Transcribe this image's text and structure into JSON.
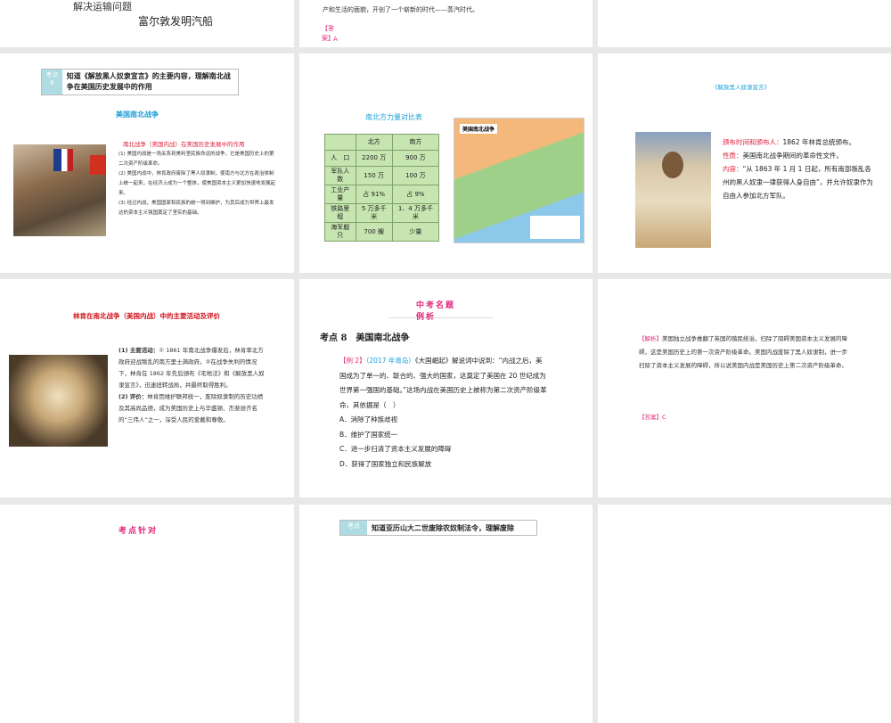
{
  "slides": {
    "s0a": {
      "line1": "解决运输问题",
      "line2": "富尔敦发明汽船"
    },
    "s0b": {
      "text": "产和生活的面貌，开创了一个崭新的时代——蒸汽时代。",
      "answer_label": "【答案】",
      "answer": "A"
    },
    "s1": {
      "kd_label": "考点8",
      "kd_text": "知道《解放黑人奴隶宣言》的主要内容，理解南北战争在美国历史发展中的作用",
      "title": "美国南北战争",
      "subtitle": "南北战争（美国内战）在美国历史发展中的作用",
      "p1": "(1) 美国内战是一场关系到美利坚民族命运的战争，它是美国历史上的第二次资产阶级革命。",
      "p2": "(2) 美国内战中，林肯政府废除了黑人奴隶制，使南方与北方在政治体制上统一起来，在经济上成为一个整体，使美国资本主义更加快速地发展起来。",
      "p3": "(3) 经过内战，美国国家和民族的统一得到维护，为其后成为世界上最发达的资本主义强国奠定了坚实的基础。"
    },
    "s2": {
      "title": "南北方力量对比表",
      "headers": [
        "",
        "北方",
        "南方"
      ],
      "rows": [
        [
          "人　口",
          "2200 万",
          "900 万"
        ],
        [
          "军队人数",
          "150 万",
          "100 万"
        ],
        [
          "工业产量",
          "占 91%",
          "占 9%"
        ],
        [
          "铁路里程",
          "5 万多千米",
          "1．4 万多千米"
        ],
        [
          "海军舰只",
          "700 艘",
          "少量"
        ]
      ],
      "map_title": "美国南北战争"
    },
    "s3": {
      "title": "《解放黑人奴隶宣言》",
      "l1": "颁布时间和颁布人：",
      "v1": "1862 年林肯总统颁布。",
      "l2": "性质：",
      "v2": "美国南北战争期间的革命性文件。",
      "l3": "内容：",
      "v3": "“从 1863 年 1 月 1 日起，所有南部叛乱各州的黑人奴隶一律获得人身自由”，并允许奴隶作为自由人参加北方军队。"
    },
    "s4": {
      "title": "林肯在南北战争（美国内战）中的主要活动及评价",
      "l1": "(1) 主要活动：",
      "v1": "① 1861 年南北战争爆发后，林肯率北方政府迎战叛乱的南方里士满政府。②在战争失利的情况下，林肯在 1862 年先后颁布《宅地法》和《解放黑人奴隶宣言》，迅速扭转战局，并最终取得胜利。",
      "l2": "(2) 评价：",
      "v2": "林肯因维护联邦统一，废除奴隶制的历史功绩及其高尚品德，成为美国历史上与华盛顿、杰斐逊齐名的“三伟人”之一，深受人民的爱戴和尊敬。"
    },
    "s5": {
      "banner1": "中考名题",
      "banner2": "例析",
      "heading": "考点 8　美国南北战争",
      "ex": "【例 2】",
      "src": "（2017 年青岛）",
      "q": "《大国崛起》解说词中说到：“内战之后，美国成为了单一的、联合的、强大的国家，这奠定了美国在 20 世纪成为世界第一强国的基础。”这场内战在美国历史上被称为第二次资产阶级革命，其依据是（　）",
      "options": [
        "A．消除了种族歧视",
        "B．维护了国家统一",
        "C．进一步扫清了资本主义发展的障碍",
        "D．获得了国家独立和民族解放"
      ]
    },
    "s6": {
      "jx_label": "【解析】",
      "jx": "美国独立战争推翻了英国的殖民统治，扫除了阻碍美国资本主义发展的障碍，这是美国历史上的第一次资产阶级革命。美国内战废除了黑人奴隶制，进一步扫除了资本主义发展的障碍，所以说美国内战是美国历史上第二次资产阶级革命。",
      "ans_label": "【答案】",
      "ans": "C"
    },
    "s7": {
      "title": "考点针对"
    },
    "s8": {
      "kd_label": "考点",
      "kd_text": "知道亚历山大二世废除农奴制法令，理解废除"
    }
  }
}
